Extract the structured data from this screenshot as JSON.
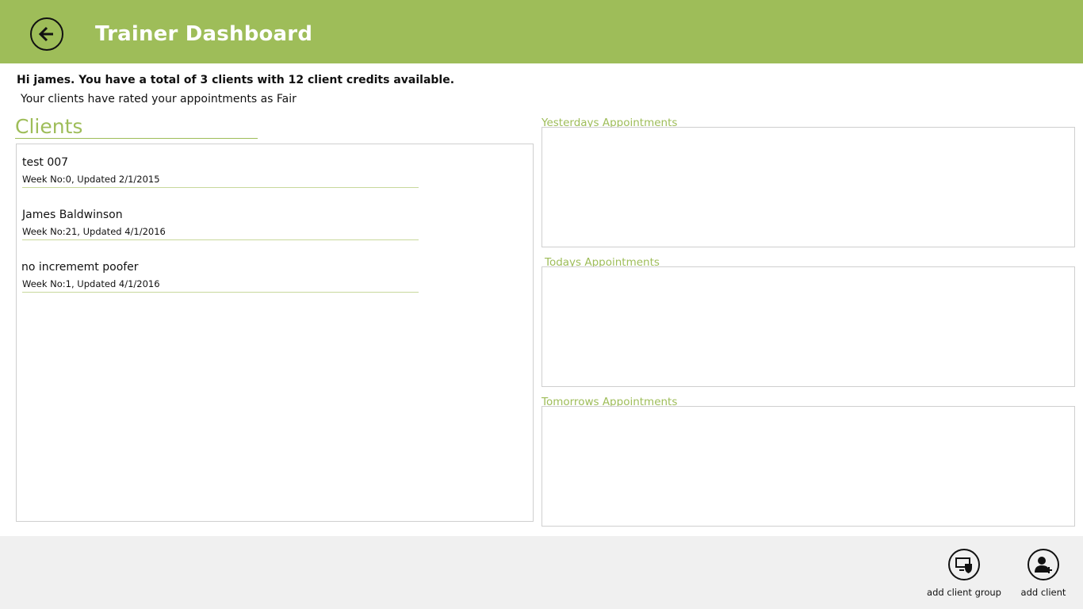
{
  "header": {
    "title": "Trainer Dashboard",
    "back_icon": "back-arrow-icon"
  },
  "summary": {
    "greeting": "Hi james. You have a total of 3 clients with 12 client credits available.",
    "rating": "Your clients have rated your appointments as Fair"
  },
  "clients": {
    "heading": "Clients",
    "items": [
      {
        "name": "test 007",
        "meta": "Week No:0, Updated 2/1/2015"
      },
      {
        "name": "James Baldwinson",
        "meta": "Week No:21, Updated 4/1/2016"
      },
      {
        "name": "no incrememt  poofer",
        "meta": "Week No:1, Updated 4/1/2016"
      }
    ]
  },
  "appointments": {
    "yesterday_label": "Yesterdays Appointments",
    "today_label": "Todays Appointments",
    "tomorrow_label": "Tomorrows Appointments"
  },
  "appbar": {
    "add_group_label": "add client group",
    "add_group_icon": "add-group-icon",
    "add_client_label": "add client",
    "add_client_icon": "add-user-icon"
  },
  "colors": {
    "accent": "#9ebd59",
    "appbar_bg": "#f0f0f0"
  }
}
